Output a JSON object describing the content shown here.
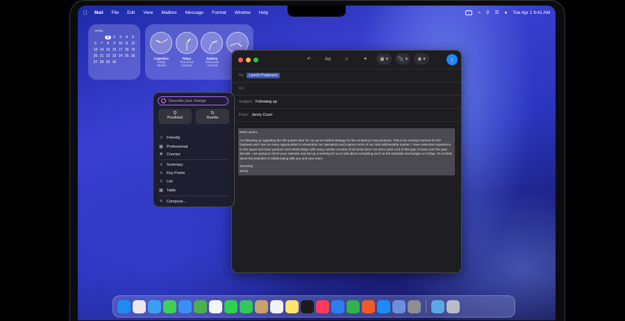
{
  "menubar": {
    "app": "Mail",
    "items": [
      "File",
      "Edit",
      "View",
      "Mailbox",
      "Message",
      "Format",
      "Window",
      "Help"
    ],
    "clock": "Tue Apr 1  9:41 AM"
  },
  "calendar": {
    "month": "APRIL",
    "days": [
      "",
      "",
      "1",
      "2",
      "3",
      "4",
      "5",
      "6",
      "7",
      "8",
      "9",
      "10",
      "11",
      "12",
      "13",
      "14",
      "15",
      "16",
      "17",
      "18",
      "19",
      "20",
      "21",
      "22",
      "23",
      "24",
      "25",
      "26",
      "27",
      "28",
      "29",
      "30"
    ],
    "today": "1"
  },
  "clocks": [
    {
      "city": "Cupertino",
      "day": "Today",
      "offset": "+0HRS"
    },
    {
      "city": "Tokyo",
      "day": "Tomorrow",
      "offset": "+16HRS"
    },
    {
      "city": "Sydney",
      "day": "Tomorrow",
      "offset": "+17HRS"
    },
    {
      "city": "",
      "day": "",
      "offset": ""
    }
  ],
  "compose": {
    "to_label": "To:",
    "to_value": "Lanchi Pederson",
    "cc_label": "Cc:",
    "subject_label": "Subject:",
    "subject_value": "Following up",
    "from_label": "From:",
    "from_value": "Jenny Court",
    "toolbar": {
      "font": "Aa"
    },
    "body": {
      "greeting": "Dear Lanchi,",
      "paragraph": "I'm following up regarding the 4th quarter plan for our go-to-market strategy for the company's new products. This is an exciting moment for the business and I see so many opportunities to streamline our operations and capture more of our total addressable market. I have extensive experience in this space and have partners and relationships with many outside vendors of all sizes since I've done quite a lot of this type of work over the past decade. I am going to check your calendar and set up a meeting for us to talk about everything such as the schedule and budget on Friday. I'm excited about the potential of collaborating with you and your team.",
      "closing": "Sincerely,",
      "signature": "Jenny"
    }
  },
  "writing_tools": {
    "placeholder": "Describe your change",
    "proofread": "Proofread",
    "rewrite": "Rewrite",
    "tones": [
      "Friendly",
      "Professional",
      "Concise"
    ],
    "formats": [
      "Summary",
      "Key Points",
      "List",
      "Table"
    ],
    "compose": "Compose..."
  },
  "dock": [
    "finder",
    "launchpad",
    "safari",
    "messages",
    "mail",
    "maps",
    "photos",
    "facetime",
    "phone",
    "contacts",
    "reminders",
    "notes",
    "tv",
    "music",
    "keynote",
    "numbers",
    "swift-playgrounds",
    "app-store",
    "preview",
    "system-settings",
    "folder",
    "trash"
  ],
  "dock_colors": [
    "#1d8cf0",
    "#e8e8ee",
    "#3aa0f5",
    "#3fd05a",
    "#3a8ff5",
    "#4caf50",
    "#f5f5f5",
    "#2fd14f",
    "#35c759",
    "#c8a26a",
    "#f2f2f2",
    "#ffe36a",
    "#1b1b1b",
    "#ff3b5c",
    "#2a7ef0",
    "#2fb34a",
    "#f05a28",
    "#1e8cf5",
    "#6c8fdc",
    "#8e8e93",
    "#5aa9e6",
    "#b9bcc6"
  ],
  "accent": "#1e88ff"
}
